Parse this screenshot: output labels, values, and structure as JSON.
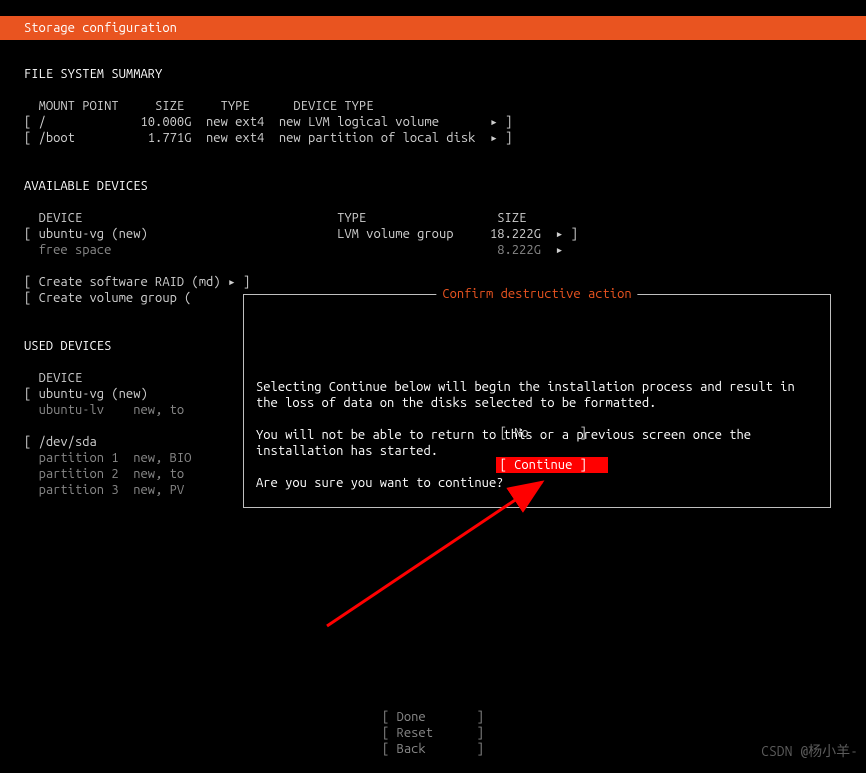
{
  "header": {
    "title": "Storage configuration"
  },
  "fs_summary": {
    "heading": "FILE SYSTEM SUMMARY",
    "cols": {
      "mount": "MOUNT POINT",
      "size": "SIZE",
      "type": "TYPE",
      "devtype": "DEVICE TYPE"
    },
    "rows": [
      {
        "mount": "/",
        "size": "10.000G",
        "type": "new ext4",
        "devtype": "new LVM logical volume"
      },
      {
        "mount": "/boot",
        "size": "1.771G",
        "type": "new ext4",
        "devtype": "new partition of local disk"
      }
    ]
  },
  "available": {
    "heading": "AVAILABLE DEVICES",
    "cols": {
      "device": "DEVICE",
      "type": "TYPE",
      "size": "SIZE"
    },
    "rows": [
      {
        "device": "ubuntu-vg (new)",
        "type": "LVM volume group",
        "size": "18.222G"
      },
      {
        "device": "free space",
        "type": "",
        "size": "8.222G"
      }
    ],
    "actions": {
      "raid": "Create software RAID (md)",
      "vg": "Create volume group ("
    }
  },
  "used": {
    "heading": "USED DEVICES",
    "cols": {
      "device": "DEVICE"
    },
    "rows": [
      {
        "device": "ubuntu-vg (new)"
      },
      {
        "device": "ubuntu-lv",
        "extra": "new, to"
      },
      {
        "device": "/dev/sda"
      },
      {
        "device": "partition 1",
        "extra": "new, BIO"
      },
      {
        "device": "partition 2",
        "extra": "new, to"
      },
      {
        "device": "partition 3",
        "extra": "new, PV"
      }
    ]
  },
  "modal": {
    "title": "Confirm destructive action",
    "p1": "Selecting Continue below will begin the installation process and result in the loss of data on the disks selected to be formatted.",
    "p2": "You will not be able to return to this or a previous screen once the installation has started.",
    "p3": "Are you sure you want to continue?",
    "no": "No",
    "continue": "Continue"
  },
  "footer": {
    "done": "Done",
    "reset": "Reset",
    "back": "Back"
  },
  "watermark": "CSDN @杨小羊-",
  "glyph": {
    "arrow": "▸"
  }
}
